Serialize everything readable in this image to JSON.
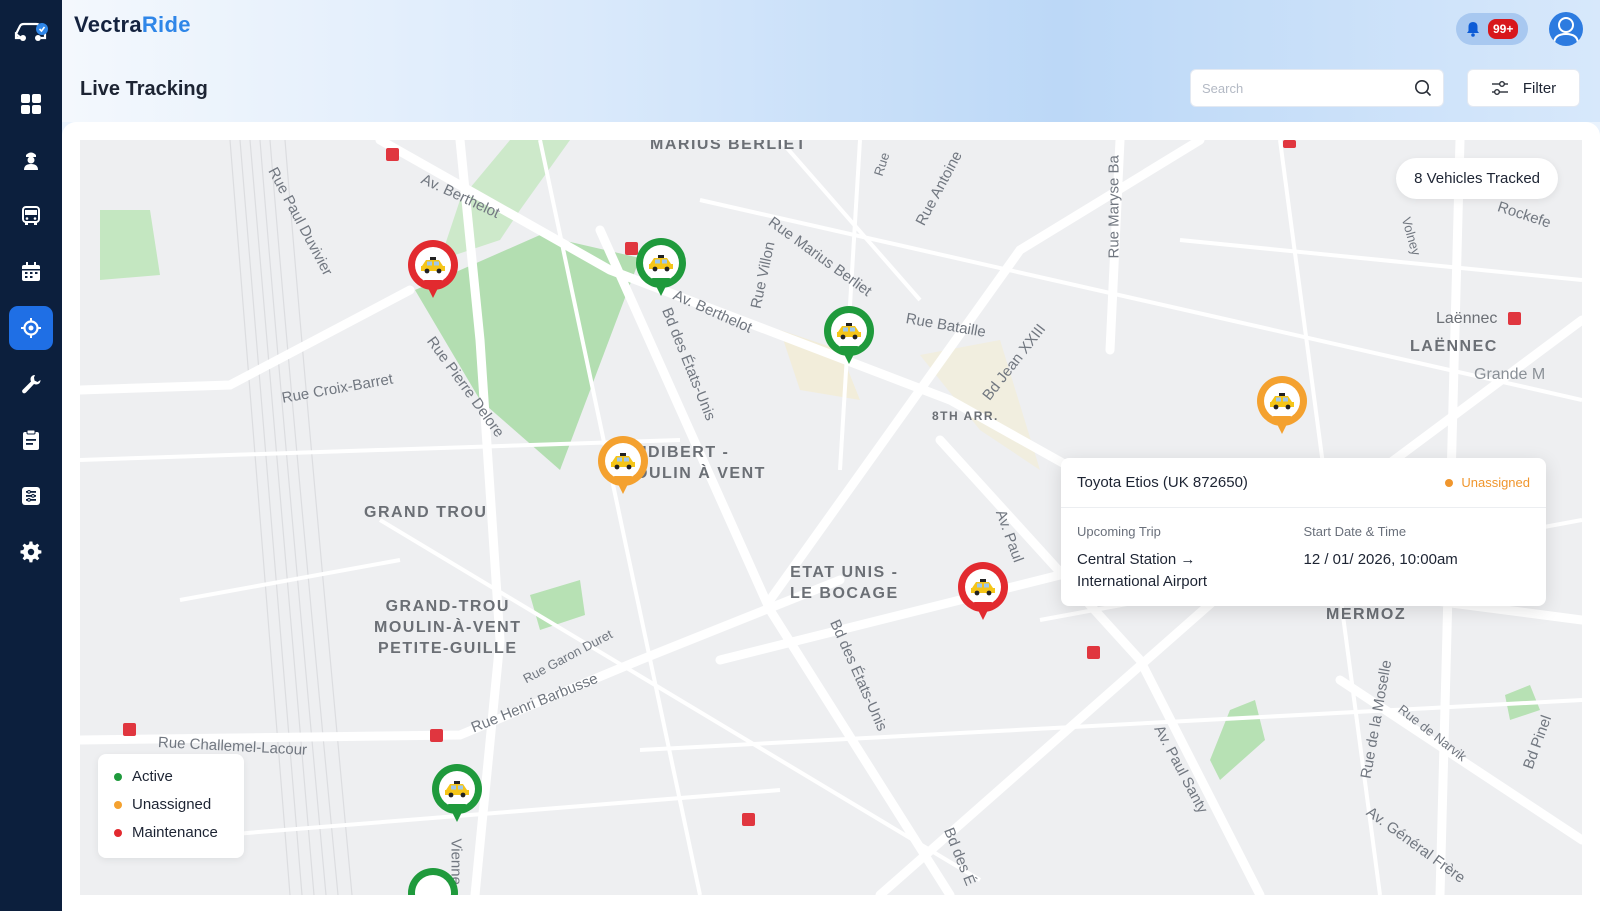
{
  "app": {
    "brand_main": "Vectra",
    "brand_accent": "Ride"
  },
  "header": {
    "page_title": "Live Tracking",
    "notification_count": "99+",
    "search_placeholder": "Search",
    "filter_label": "Filter"
  },
  "sidebar": {
    "items": [
      {
        "icon": "dashboard-icon",
        "active": false
      },
      {
        "icon": "driver-icon",
        "active": false
      },
      {
        "icon": "bus-icon",
        "active": false
      },
      {
        "icon": "calendar-icon",
        "active": false
      },
      {
        "icon": "location-target-icon",
        "active": true
      },
      {
        "icon": "wrench-icon",
        "active": false
      },
      {
        "icon": "clipboard-icon",
        "active": false
      },
      {
        "icon": "list-icon",
        "active": false
      },
      {
        "icon": "settings-icon",
        "active": false
      }
    ]
  },
  "map": {
    "vehicles_tracked": "8 Vehicles Tracked",
    "area_labels": {
      "marius_berliet": "MARIUS BERLIET",
      "audibert": "UDIBERT -\nOULIN À VENT",
      "grand_trou": "GRAND TROU",
      "grand_trou_moulin": "GRAND-TROU\nMOULIN-À-VENT\nPETITE-GUILLE",
      "etats_unis": "ETAT UNIS -\nLE BOCAGE",
      "eighth_arr": "8TH ARR.",
      "laennec_upper": "LAËNNEC",
      "mermoz": "MERMOZ",
      "laennec_metro": "Laënnec",
      "grande_m": "Grande M"
    },
    "street_labels": {
      "av_berthelot_1": "Av. Berthelot",
      "av_berthelot_2": "Av. Berthelot",
      "rue_paul_duvivier": "Rue Paul Duvivier",
      "rue_pierre_delore": "Rue Pierre Delore",
      "rue_croix_barret": "Rue Croix-Barret",
      "bd_etats_unis_1": "Bd des États-Unis",
      "bd_etats_unis_2": "Bd des États-Unis",
      "bd_etats_unis_3": "Bd des É",
      "rue_marius_berliet": "Rue Marius Berliet",
      "rue_bataille": "Rue Bataille",
      "bd_jean_xxiii": "Bd Jean XXIII",
      "rue_antoine": "Rue Antoine",
      "rue_maryse_ba": "Rue Maryse Ba",
      "rue_villon": "Rue Villon",
      "rue_garon_duret": "Rue Garon Duret",
      "rue_henri_barbusse": "Rue Henri Barbusse",
      "rue_challemel_lacour": "Rue Challemel-Lacour",
      "av_paul_santy": "Av. Paul Santy",
      "av_paul_2": "Av. Paul",
      "rue_de_la_moselle": "Rue de la Moselle",
      "rue_de_narvik": "Rue de Narvik",
      "av_general_frere": "Av. Général Frère",
      "bd_pinel": "Bd Pinel",
      "rue_volney": "Volney",
      "rockefe": "Rockefe",
      "vienne": "Vienne",
      "rue_short": "Rue"
    },
    "legend": [
      {
        "label": "Active",
        "color": "#1f9a3c"
      },
      {
        "label": "Unassigned",
        "color": "#f4a12f"
      },
      {
        "label": "Maintenance",
        "color": "#e22a2f"
      }
    ],
    "popup": {
      "vehicle": "Toyota Etios (UK 872650)",
      "status": "Unassigned",
      "status_color": "#f0962d",
      "trip_label": "Upcoming Trip",
      "trip_value": "Central Station →\nInternational Airport",
      "start_label": "Start Date & Time",
      "start_value": "12 / 01/ 2026, 10:00am"
    }
  }
}
